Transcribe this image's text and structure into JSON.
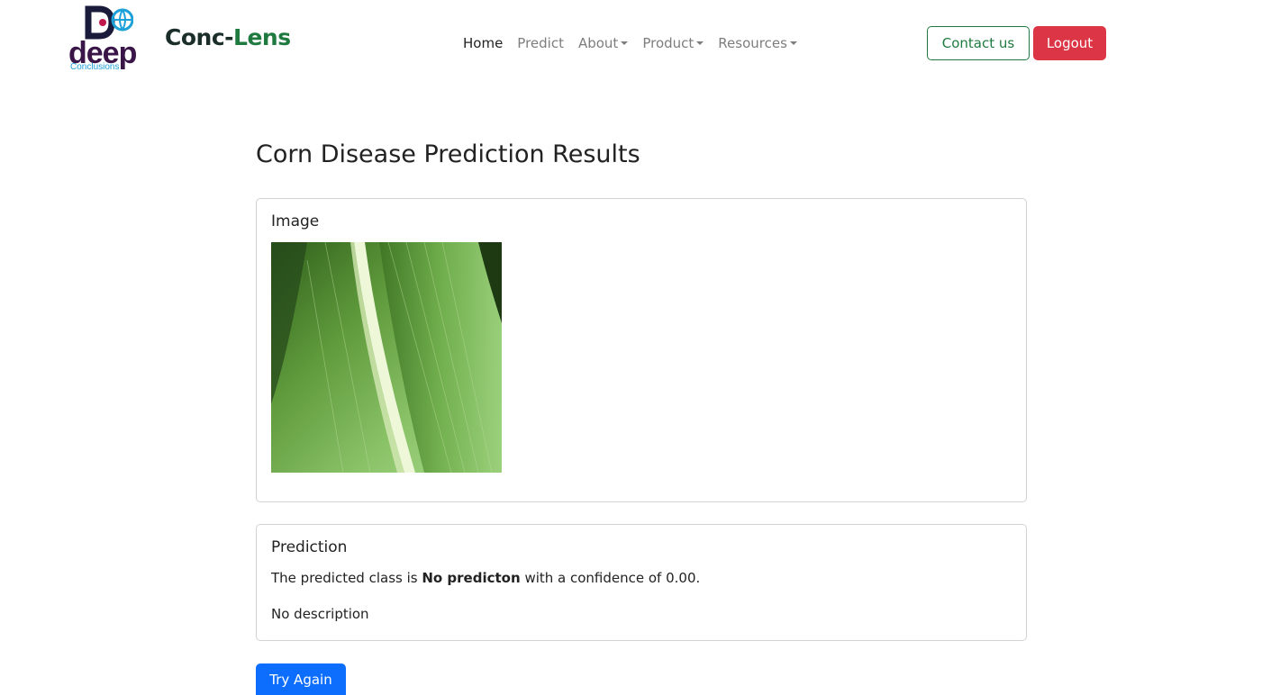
{
  "logo": {
    "word": "deep",
    "sub": "Conclusions"
  },
  "brand": {
    "part1": "Conc-",
    "part2": "Lens"
  },
  "nav": {
    "home": "Home",
    "predict": "Predict",
    "about": "About",
    "product": "Product",
    "resources": "Resources"
  },
  "buttons": {
    "contact": "Contact us",
    "logout": "Logout",
    "try_again": "Try Again"
  },
  "page": {
    "title": "Corn Disease Prediction Results"
  },
  "image_card": {
    "title": "Image"
  },
  "prediction_card": {
    "title": "Prediction",
    "prefix": "The predicted class is ",
    "class_name": "No predicton",
    "middle": " with a confidence of ",
    "confidence": "0.00",
    "suffix": ".",
    "description": "No description"
  },
  "colors": {
    "brand_green": "#1f7a3f",
    "danger": "#dc3545",
    "primary": "#0d6efd",
    "logo_purple": "#3a1548",
    "logo_blue": "#1ea0d8"
  }
}
